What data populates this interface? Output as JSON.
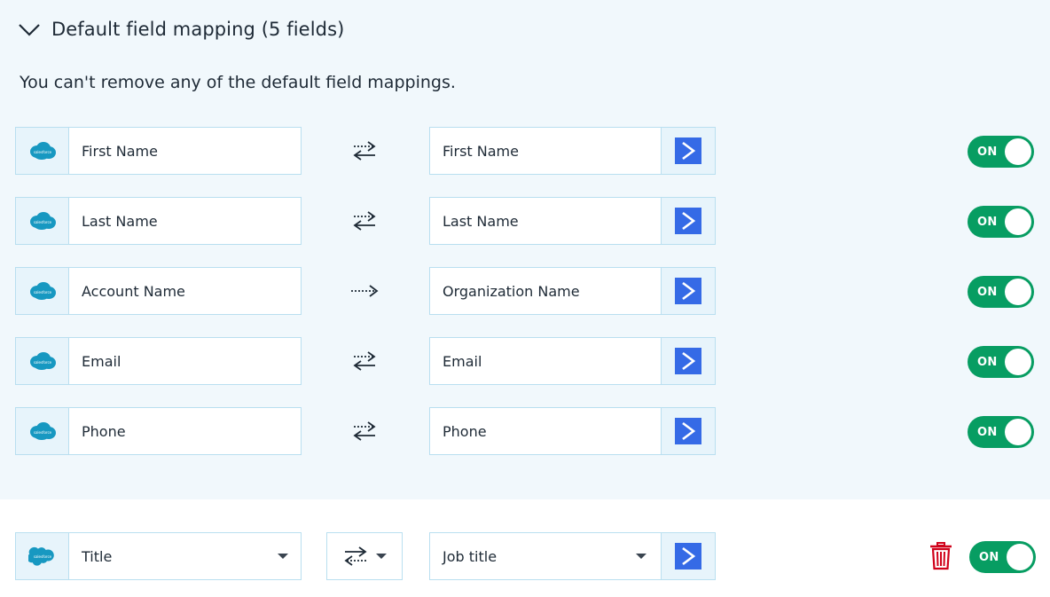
{
  "section": {
    "title": "Default field mapping (5 fields)",
    "subtitle": "You can't remove any of the default field mappings."
  },
  "default_mappings": [
    {
      "source": "First Name",
      "target": "First Name",
      "direction": "bidirectional",
      "toggle": "ON"
    },
    {
      "source": "Last Name",
      "target": "Last Name",
      "direction": "bidirectional",
      "toggle": "ON"
    },
    {
      "source": "Account Name",
      "target": "Organization Name",
      "direction": "one-way",
      "toggle": "ON"
    },
    {
      "source": "Email",
      "target": "Email",
      "direction": "bidirectional",
      "toggle": "ON"
    },
    {
      "source": "Phone",
      "target": "Phone",
      "direction": "bidirectional",
      "toggle": "ON"
    }
  ],
  "custom_mapping": {
    "source": "Title",
    "target": "Job title",
    "direction": "bidirectional",
    "toggle": "ON"
  },
  "icons": {
    "source_logo": "salesforce-logo",
    "target_logo": "activecampaign-logo",
    "delete": "trash-icon",
    "collapse": "chevron-down-icon"
  },
  "colors": {
    "toggle_on": "#079d62",
    "salesforce_blue": "#1798c1",
    "activecampaign_blue": "#356ae6",
    "delete_red": "#d0021b",
    "section_bg": "#f1f8fc",
    "border": "#b9dff0"
  }
}
